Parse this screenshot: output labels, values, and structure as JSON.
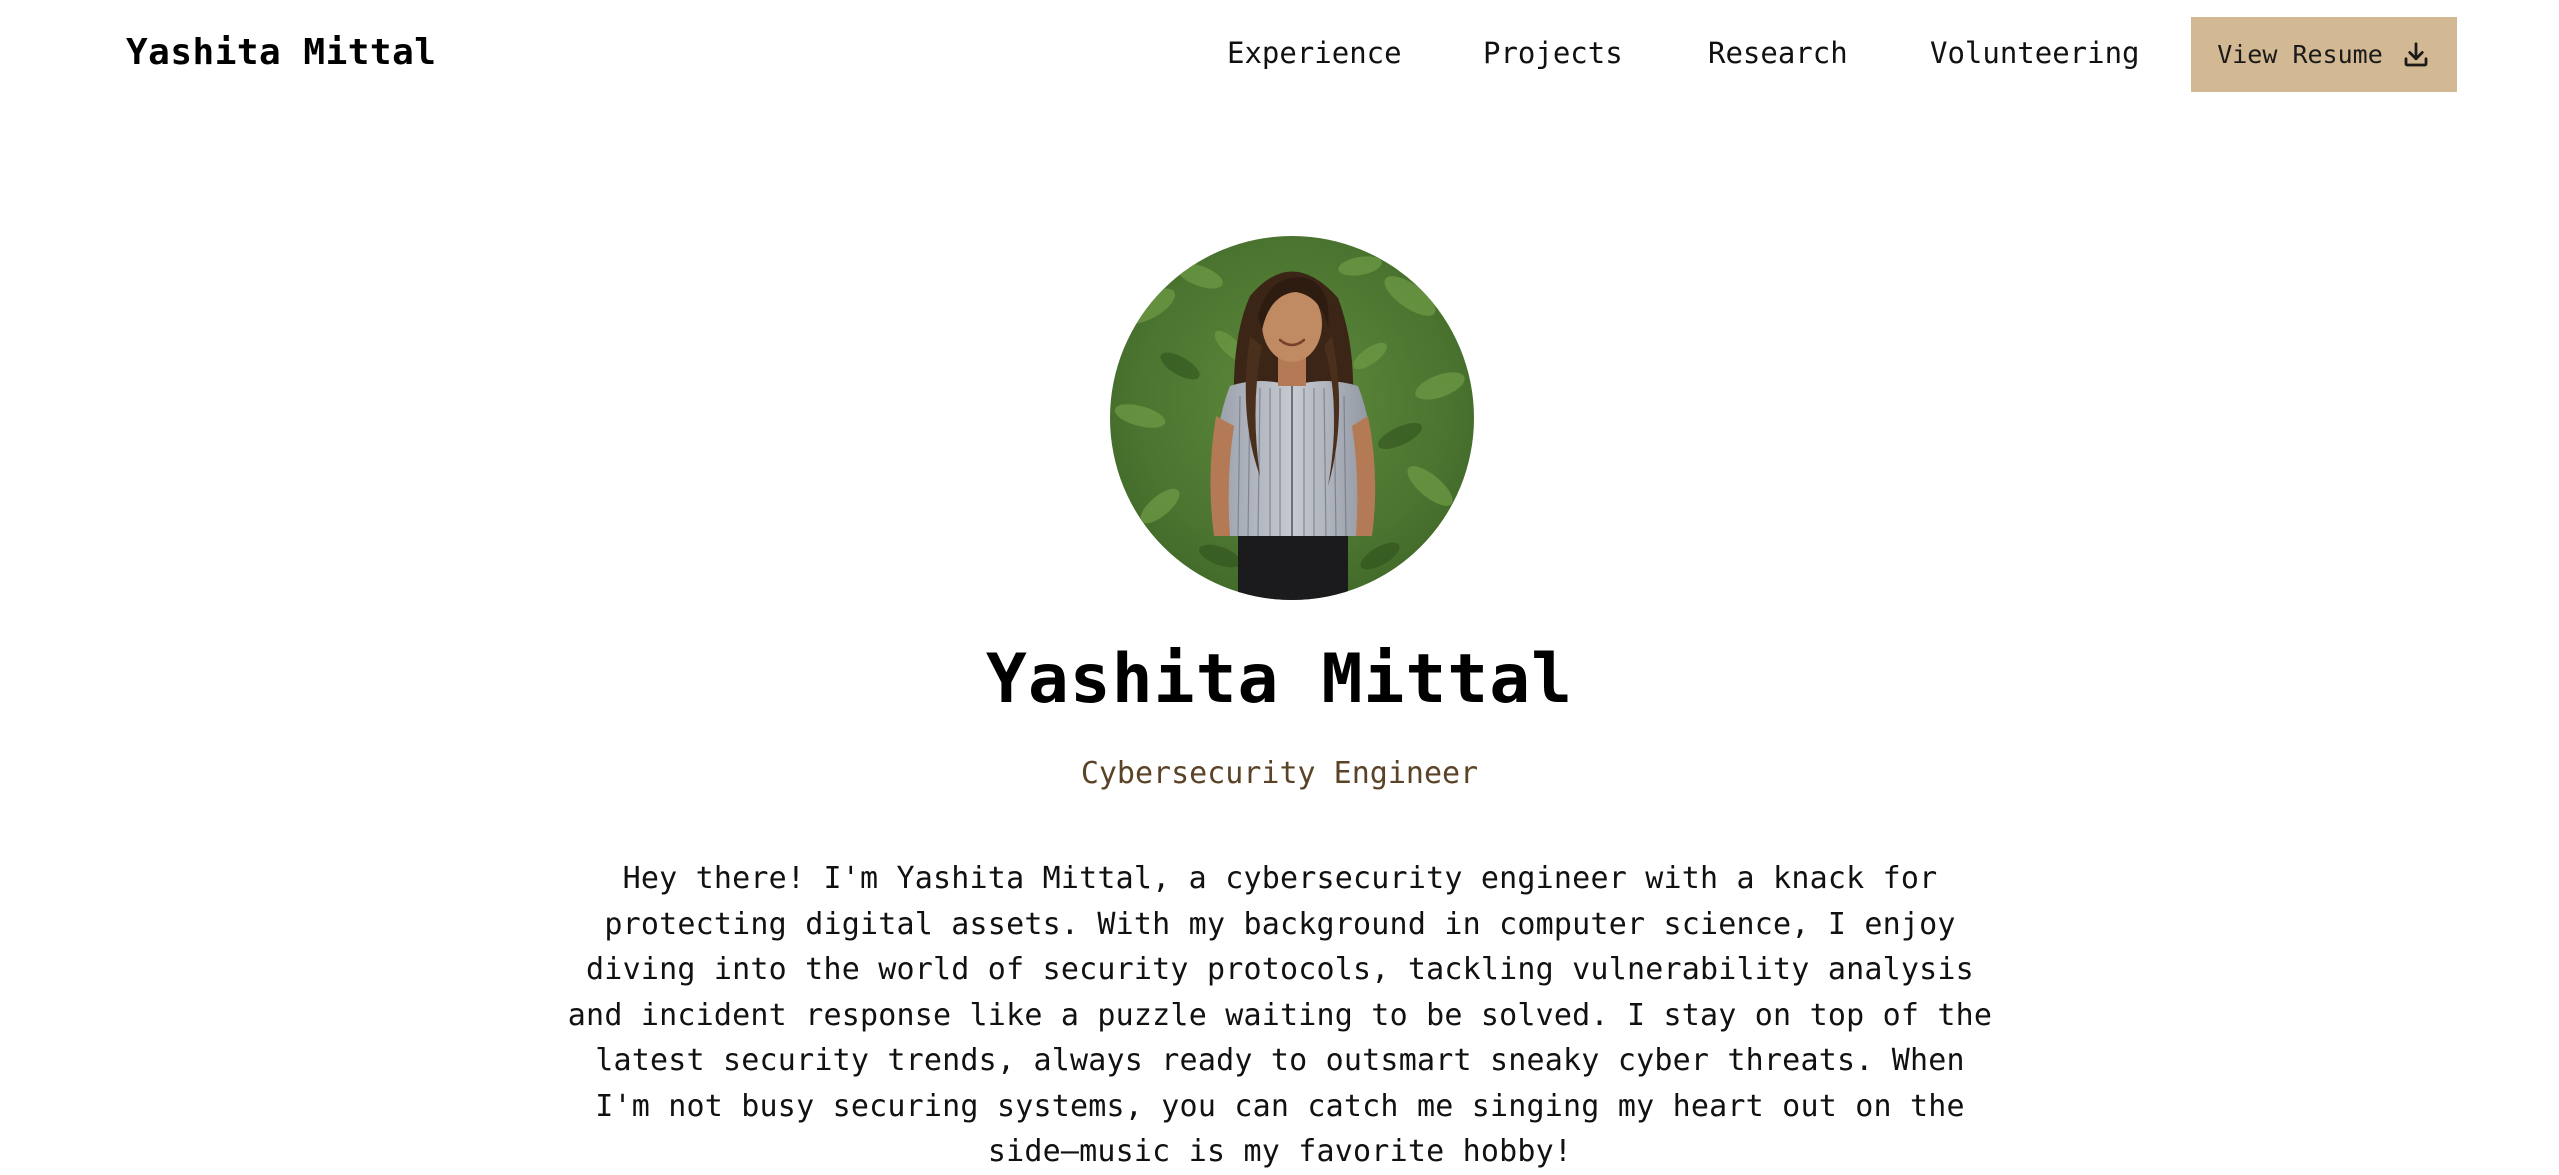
{
  "header": {
    "brand": "Yashita Mittal",
    "nav": {
      "experience": "Experience",
      "projects": "Projects",
      "research": "Research",
      "volunteering": "Volunteering"
    },
    "resume_label": "View Resume",
    "resume_icon": "download-icon",
    "resume_color": "#d2b893"
  },
  "hero": {
    "name": "Yashita Mittal",
    "role": "Cybersecurity Engineer",
    "bio": "Hey there! I'm Yashita Mittal, a cybersecurity engineer with a knack for protecting digital assets. With my background in computer science, I enjoy diving into the world of security protocols, tackling vulnerability analysis and incident response like a puzzle waiting to be solved. I stay on top of the latest security trends, always ready to outsmart sneaky cyber threats. When I'm not busy securing systems, you can catch me singing my heart out on the side—music is my favorite hobby!",
    "role_color": "#5a4326"
  }
}
